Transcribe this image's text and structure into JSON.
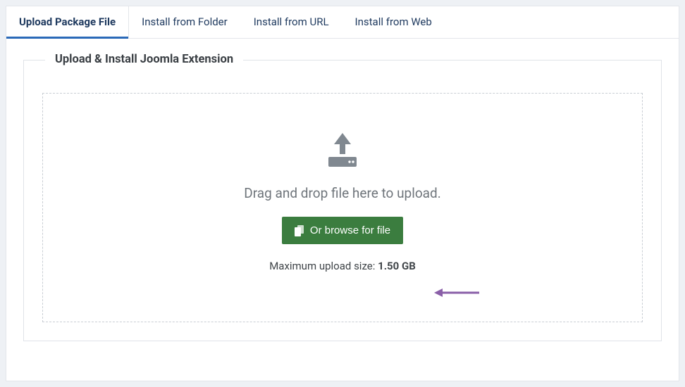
{
  "tabs": [
    {
      "label": "Upload Package File",
      "active": true
    },
    {
      "label": "Install from Folder",
      "active": false
    },
    {
      "label": "Install from URL",
      "active": false
    },
    {
      "label": "Install from Web",
      "active": false
    }
  ],
  "fieldset": {
    "legend": "Upload & Install Joomla Extension"
  },
  "dropzone": {
    "instruction": "Drag and drop file here to upload.",
    "browse_label": "Or browse for file",
    "max_upload_label": "Maximum upload size: ",
    "max_upload_value": "1.50 GB"
  },
  "colors": {
    "accent": "#2a69b8",
    "button": "#3b7d3f",
    "annotation": "#8a5fa8"
  }
}
